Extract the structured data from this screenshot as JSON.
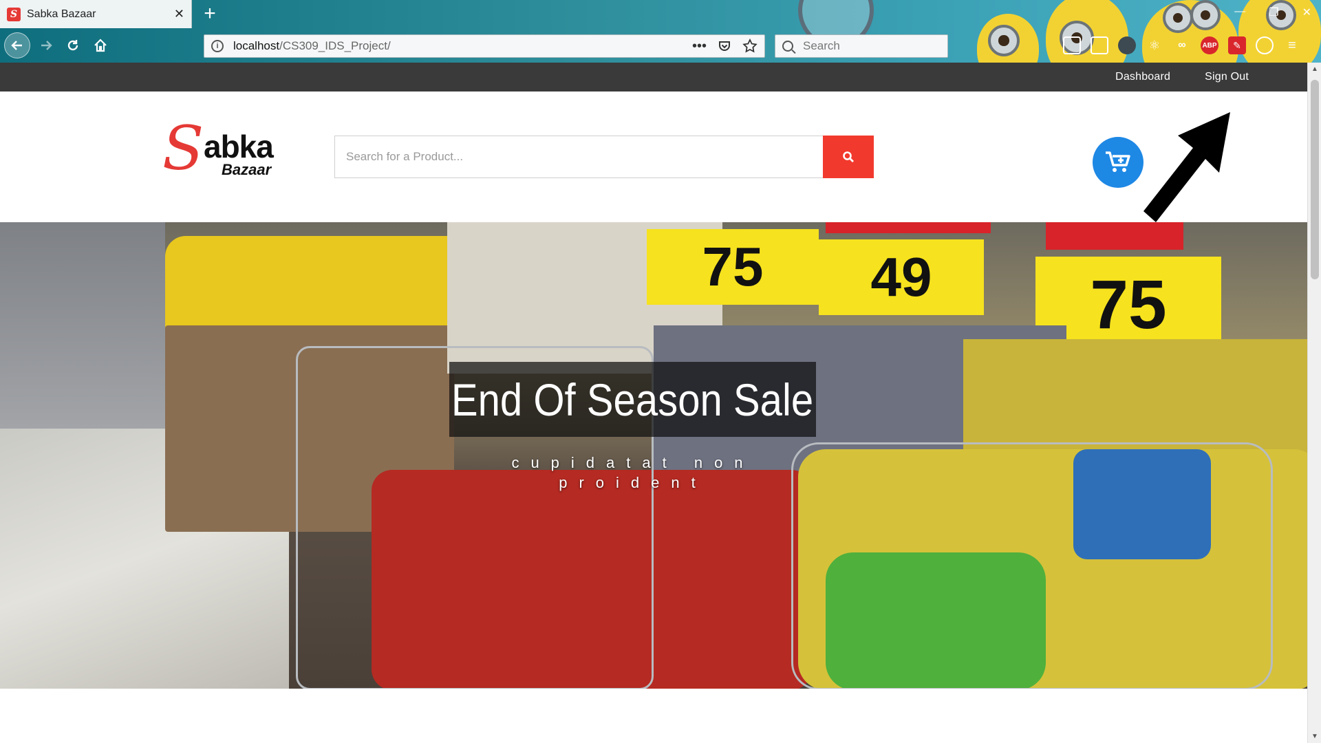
{
  "browser": {
    "tab_title": "Sabka Bazaar",
    "url_host": "localhost",
    "url_path": "/CS309_IDS_Project/",
    "search_placeholder": "Search",
    "extension_icons": [
      "abp-icon",
      "pen-icon"
    ],
    "abp_label": "ABP"
  },
  "topbar": {
    "links": [
      "Dashboard",
      "Sign Out"
    ]
  },
  "header": {
    "logo_s": "S",
    "logo_word1": "abka",
    "logo_word2": "Bazaar",
    "search_placeholder": "Search for a Product..."
  },
  "hero": {
    "title": "End Of Season Sale",
    "subtitle": "cupidatat non proident",
    "price_tags": [
      "75",
      "49",
      "75"
    ]
  },
  "colors": {
    "topbar_bg": "#3a3a3a",
    "search_button": "#f2392d",
    "cart_button": "#1e88e5",
    "logo_red": "#e53935"
  }
}
